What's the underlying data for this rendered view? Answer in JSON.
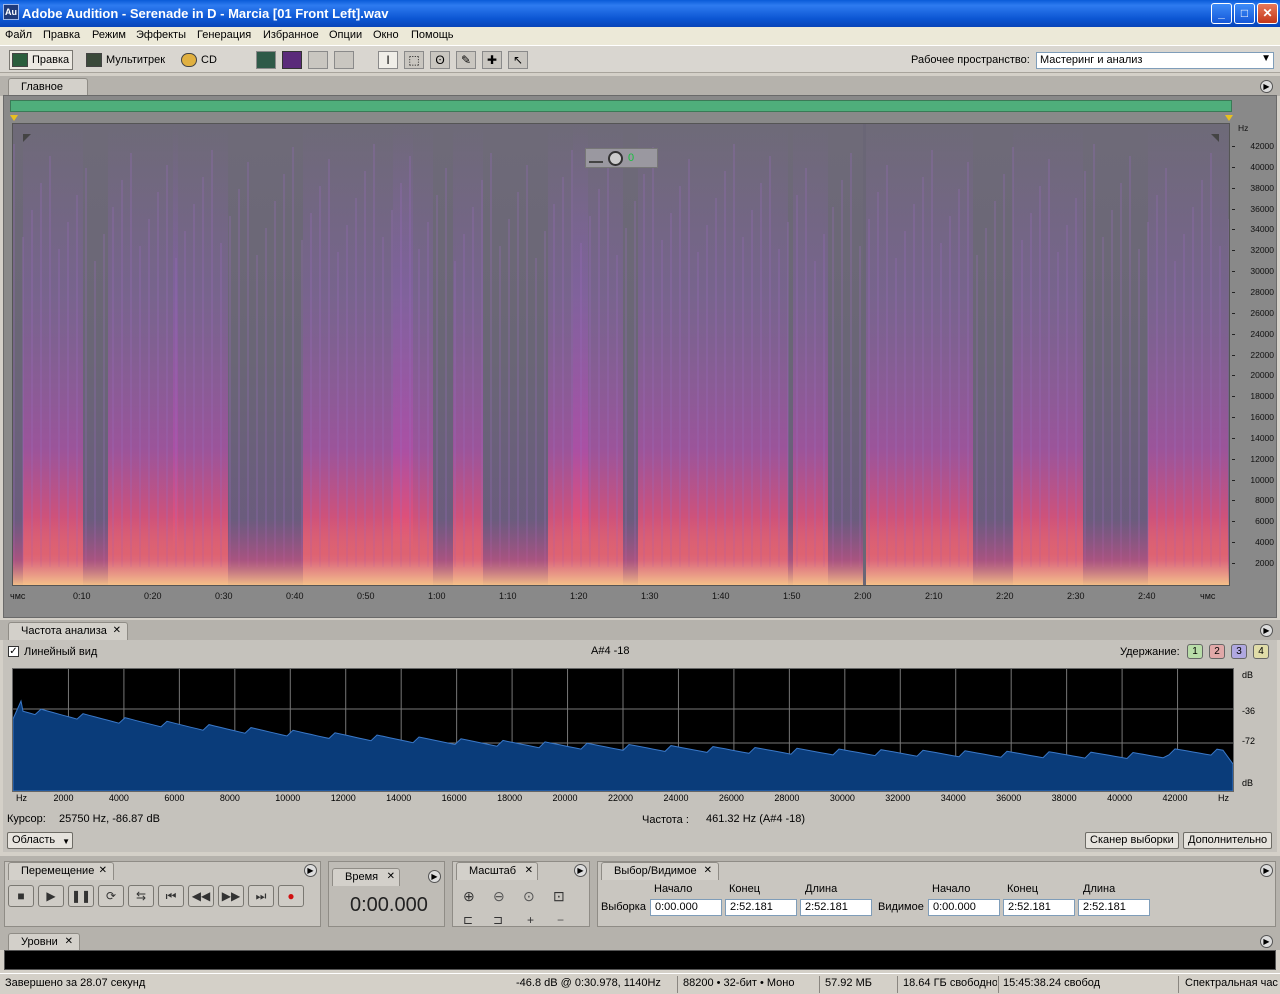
{
  "window": {
    "icon_text": "Au",
    "title": "Adobe Audition - Serenade in D - Marcia [01 Front Left].wav",
    "min": "_",
    "max": "□",
    "close": "✕"
  },
  "menu": [
    "Файл",
    "Правка",
    "Режим",
    "Эффекты",
    "Генерация",
    "Избранное",
    "Опции",
    "Окно",
    "Помощь"
  ],
  "toolbar": {
    "edit": "Правка",
    "multitrack": "Мультитрек",
    "cd": "CD",
    "workspace_label": "Рабочее пространство:",
    "workspace_value": "Мастеринг и анализ"
  },
  "main": {
    "tab": "Главное",
    "volume_value": "0",
    "hz_unit": "Hz",
    "hz_ticks": [
      "42000",
      "40000",
      "38000",
      "36000",
      "34000",
      "32000",
      "30000",
      "28000",
      "26000",
      "24000",
      "22000",
      "20000",
      "18000",
      "16000",
      "14000",
      "12000",
      "10000",
      "8000",
      "6000",
      "4000",
      "2000"
    ],
    "time_ticks": [
      "чмс",
      "0:10",
      "0:20",
      "0:30",
      "0:40",
      "0:50",
      "1:00",
      "1:10",
      "1:20",
      "1:30",
      "1:40",
      "1:50",
      "2:00",
      "2:10",
      "2:20",
      "2:30",
      "2:40",
      "чмс"
    ]
  },
  "freq_panel": {
    "tab": "Частота  анализа",
    "linear_label": "Линейный вид",
    "note_readout": "A#4 -18",
    "hold_label": "Удержание:",
    "holds": [
      "1",
      "2",
      "3",
      "4"
    ],
    "hold_colors": [
      "#b8dca8",
      "#e0a8a8",
      "#b0a8e0",
      "#e0dca8"
    ],
    "db_labels": [
      "dB",
      "-36",
      "-72",
      "dB"
    ],
    "x_labels": [
      "Hz",
      "2000",
      "4000",
      "6000",
      "8000",
      "10000",
      "12000",
      "14000",
      "16000",
      "18000",
      "20000",
      "22000",
      "24000",
      "26000",
      "28000",
      "30000",
      "32000",
      "34000",
      "36000",
      "38000",
      "40000",
      "42000",
      "Hz"
    ],
    "cursor_label": "Курсор:",
    "cursor_value": "25750 Hz, -86.87 dB",
    "freq_label": "Частота :",
    "freq_value": "461.32 Hz (A#4 -18)",
    "region_btn": "Область",
    "scan_btn": "Сканер выборки",
    "more_btn": "Дополнительно"
  },
  "transport": {
    "tab": "Перемещение",
    "buttons": [
      "■",
      "▶",
      "❚❚",
      "⟳",
      "⇆",
      "⏮",
      "◀◀",
      "▶▶",
      "⏭",
      "●"
    ]
  },
  "time_panel": {
    "tab": "Время",
    "value": "0:00.000"
  },
  "zoom_panel": {
    "tab": "Масштаб"
  },
  "selection": {
    "tab": "Выбор/Видимое",
    "start": "Начало",
    "end": "Конец",
    "length": "Длина",
    "sel_label": "Выборка",
    "sel_start": "0:00.000",
    "sel_end": "2:52.181",
    "sel_len": "2:52.181",
    "vis_label": "Видимое",
    "vis_start": "0:00.000",
    "vis_end": "2:52.181",
    "vis_len": "2:52.181"
  },
  "levels": {
    "tab": "Уровни"
  },
  "status": {
    "done": "Завершено за 28.07 секунд",
    "cursor": "-46.8 dB @   0:30.978, 1140Hz",
    "format": "88200 • 32-бит • Моно",
    "size": "57.92 МБ",
    "free": "18.64 ГБ свободно",
    "time_free": "15:45:38.24 свобод",
    "view": "Спектральная час"
  }
}
